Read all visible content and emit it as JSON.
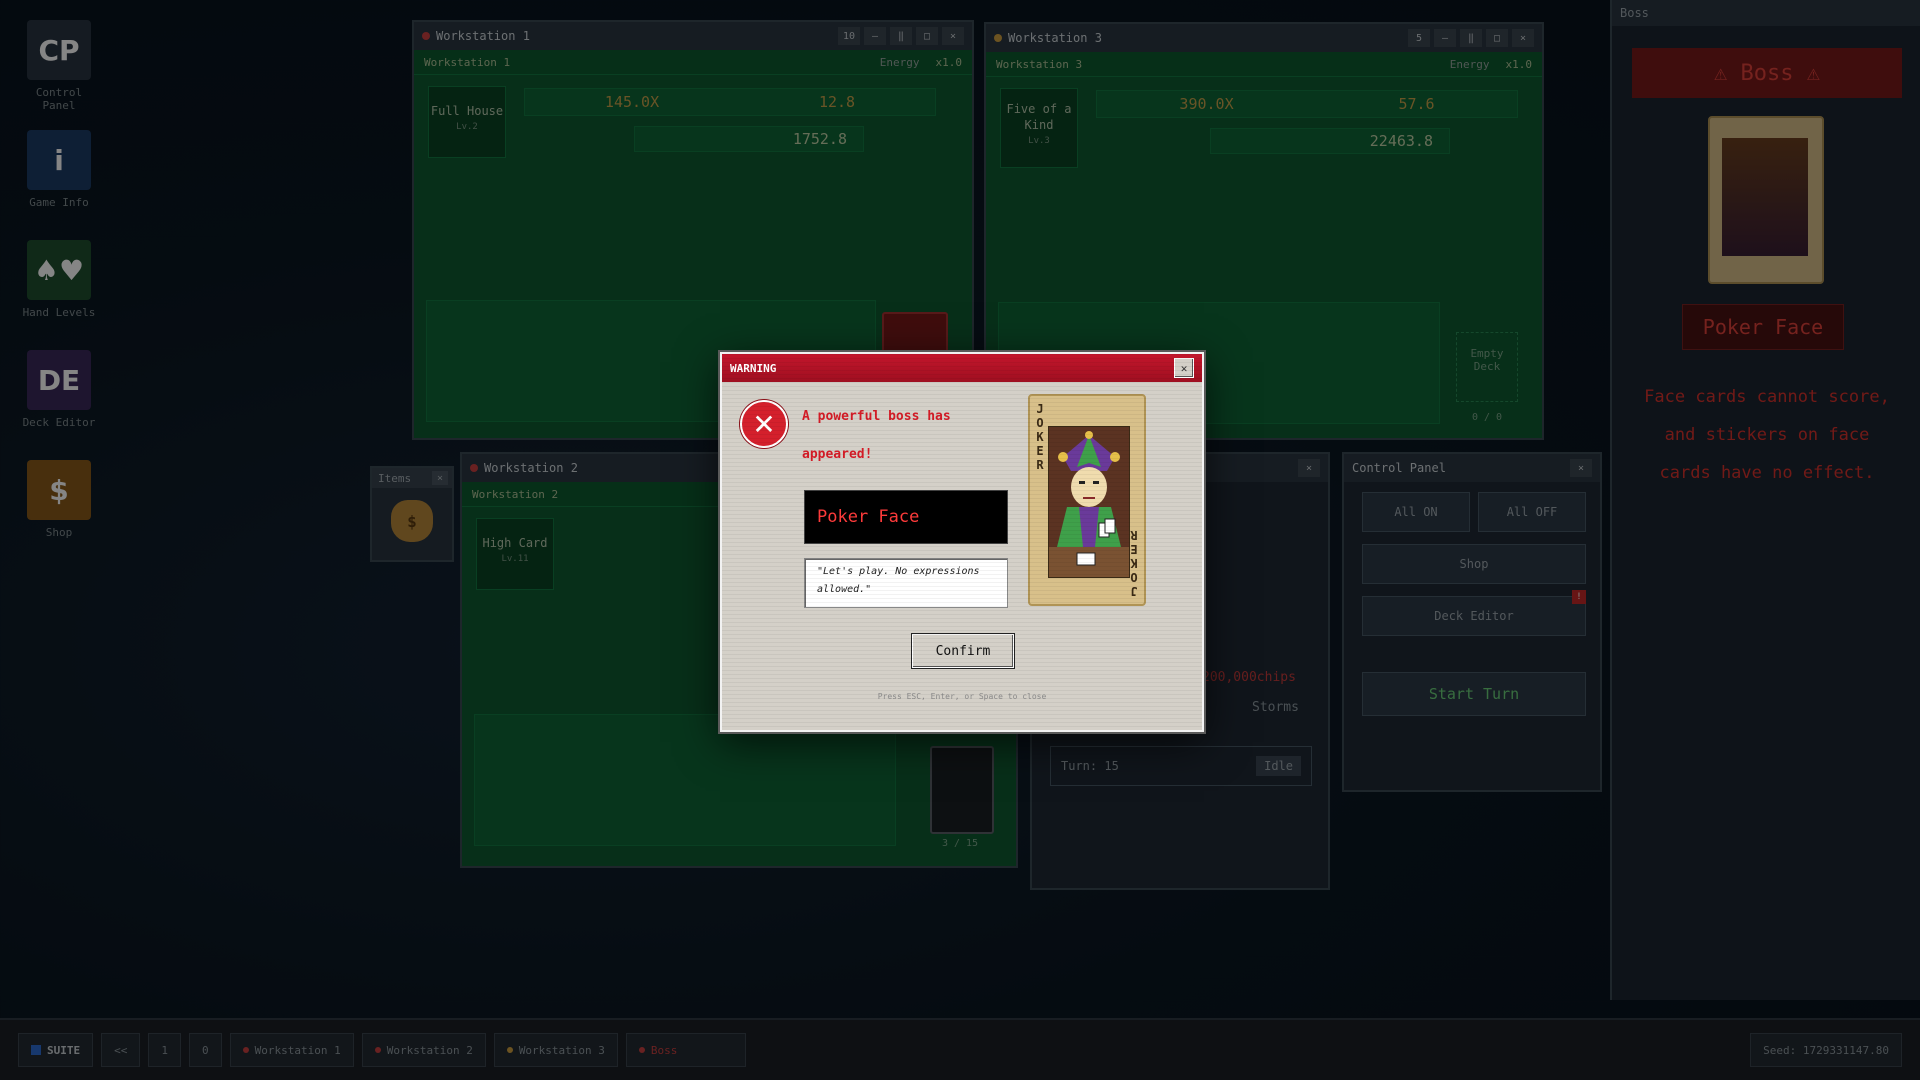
{
  "desktop_icons": [
    {
      "label": "Control Panel",
      "glyph": "CP",
      "color": "#2a3542"
    },
    {
      "label": "Game Info",
      "glyph": "i",
      "color": "#1c3c66"
    },
    {
      "label": "Hand Levels",
      "glyph": "♠♥",
      "color": "#1f4f2f"
    },
    {
      "label": "Deck Editor",
      "glyph": "DE",
      "color": "#3a2a5a"
    },
    {
      "label": "Shop",
      "glyph": "$",
      "color": "#8a5a1a"
    }
  ],
  "workstation1": {
    "title": "Workstation 1",
    "subtitle": "Workstation 1",
    "energy": "Energy",
    "mult": "x1.0",
    "hand": "Full House",
    "hand_level": "Lv.2",
    "chips": "145.0X",
    "mult_val": "12.8",
    "score": "1752.8"
  },
  "workstation3": {
    "title": "Workstation 3",
    "subtitle": "Workstation 3",
    "energy": "Energy",
    "mult": "x1.0",
    "hand": "Five of a Kind",
    "hand_level": "Lv.3",
    "chips": "390.0X",
    "mult_val": "57.6",
    "score": "22463.8",
    "deck_label": "Empty Deck",
    "deck_count": "0 / 0"
  },
  "workstation2": {
    "title": "Workstation 2",
    "subtitle": "Workstation 2",
    "hand": "High Card",
    "hand_level": "Lv.11",
    "deck_count": "3 / 15"
  },
  "items": {
    "title": "Items"
  },
  "middle_panel": {
    "target": "200,000chips",
    "status": "Storms",
    "turn": "Turn: 15",
    "idle": "Idle"
  },
  "control_panel": {
    "title": "Control Panel",
    "all_on": "All ON",
    "all_off": "All OFF",
    "shop": "Shop",
    "deck_editor": "Deck Editor",
    "start_turn": "Start Turn"
  },
  "boss_panel": {
    "title": "Boss",
    "banner": "⚠ Boss ⚠",
    "name": "Poker Face",
    "effect": "Face cards cannot score, and stickers on face cards have no effect."
  },
  "dialog": {
    "title": "WARNING",
    "message": "A powerful boss has appeared!",
    "boss_name": "Poker Face",
    "quote": "\"Let's play. No expressions allowed.\"",
    "card_top": "JOKER",
    "card_bottom": "JOKER",
    "confirm": "Confirm",
    "hint": "Press ESC, Enter, or Space to close"
  },
  "taskbar": {
    "start": "SUITE",
    "quick": [
      "<<",
      "1",
      "0"
    ],
    "tasks": [
      {
        "label": "Workstation 1",
        "color": "#c94040"
      },
      {
        "label": "Workstation 2",
        "color": "#c94040"
      },
      {
        "label": "Workstation 3",
        "color": "#d0a040"
      },
      {
        "label": "Boss",
        "color": "#c94040"
      }
    ],
    "clock": "Seed: 1729331147.80"
  }
}
